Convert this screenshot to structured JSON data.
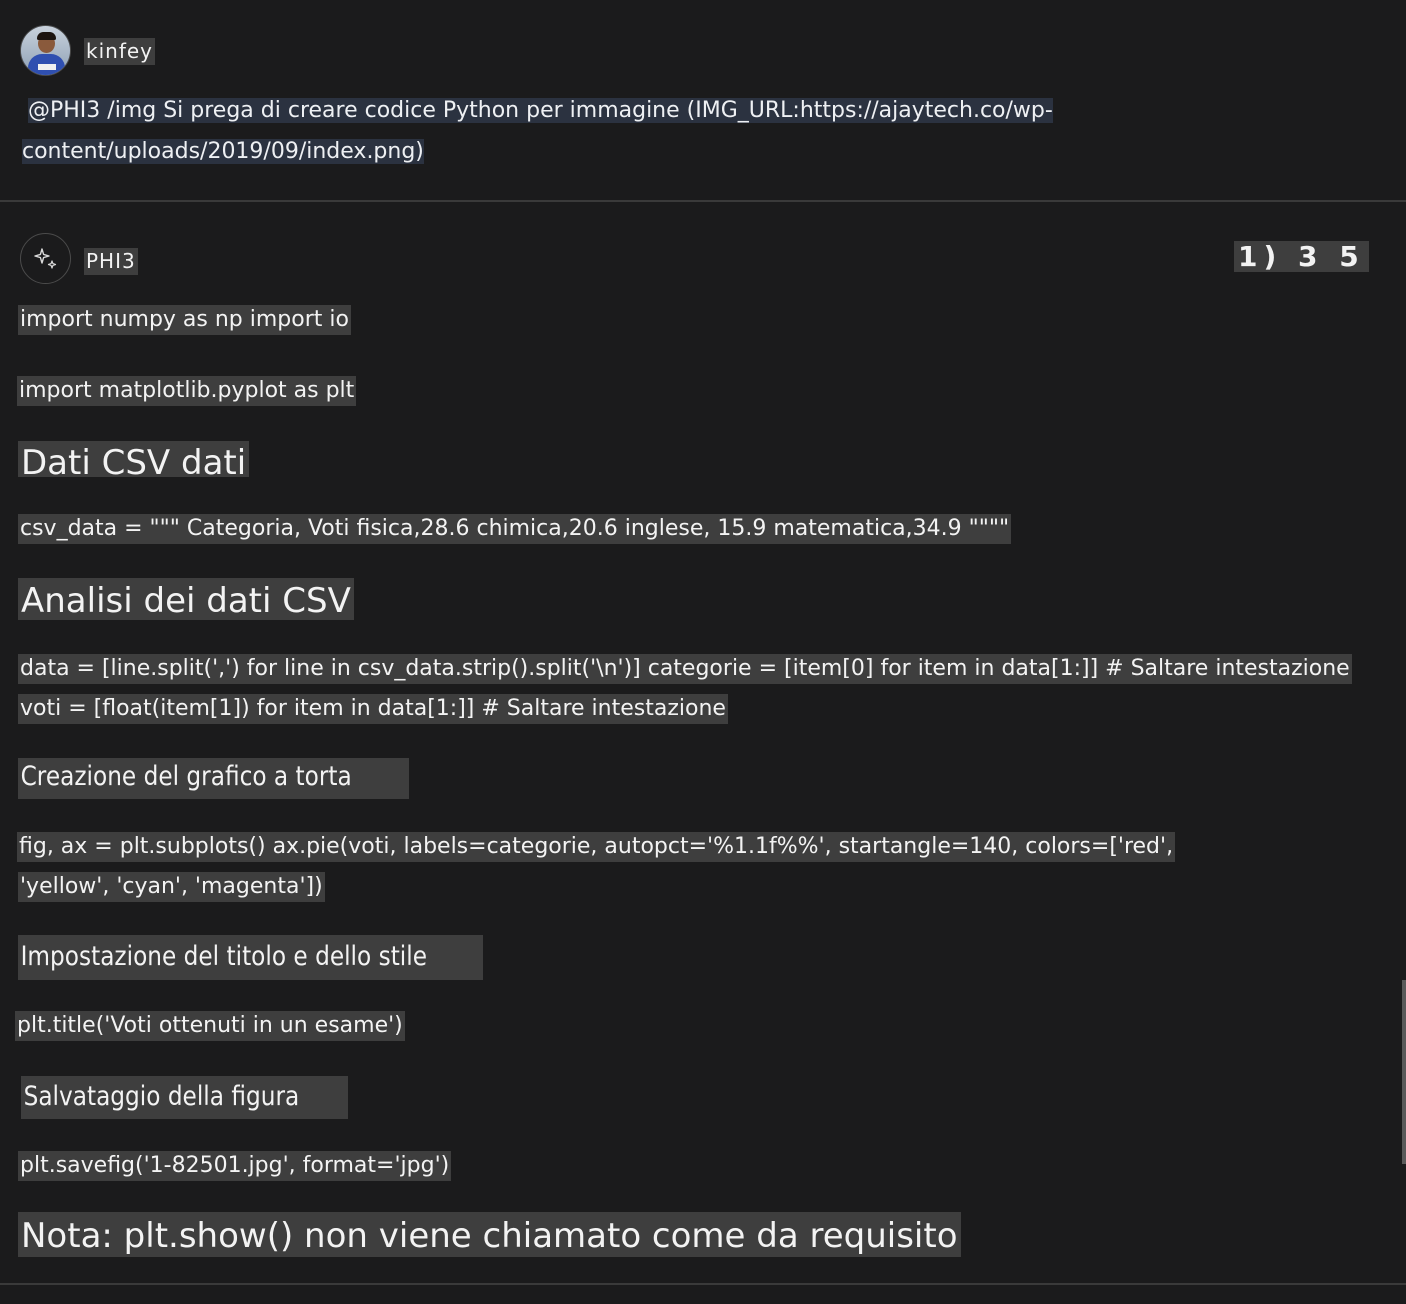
{
  "user": {
    "name": "kinfey",
    "prompt_line1": "@PHI3 /img Si prega di creare codice Python per immagine (IMG_URL:https://ajaytech.co/wp-",
    "prompt_line2": "content/uploads/2019/09/index.png)"
  },
  "bot": {
    "name": "PHI3",
    "counter": "1) 3 5",
    "icon": "sparkle-icon"
  },
  "response": {
    "code_imports_1": "import numpy as np import io",
    "code_imports_2": "import matplotlib.pyplot as plt",
    "heading_csv": "Dati CSV dati",
    "code_csv": "csv_data = \"\"\" Categoria, Voti fisica,28.6 chimica,20.6 inglese, 15.9 matematica,34.9 \"\"\"\"",
    "heading_analysis": "Analisi dei dati CSV",
    "code_analysis_1": "data = [line.split(',') for line in csv_data.strip().split('\\n')] categorie = [item[0] for item in data[1:]] # Saltare intestazione",
    "code_analysis_2": "voti = [float(item[1]) for item in data[1:]] # Saltare intestazione",
    "heading_pie": "Creazione del grafico a torta",
    "code_pie_1": "fig, ax = plt.subplots() ax.pie(voti, labels=categorie, autopct='%1.1f%%', startangle=140, colors=['red',",
    "code_pie_2": "'yellow', 'cyan', 'magenta'])",
    "heading_title": "Impostazione del titolo e dello stile",
    "code_title": "plt.title('Voti ottenuti in un esame')",
    "heading_save": "Salvataggio della figura",
    "code_save": "plt.savefig('1-82501.jpg', format='jpg')",
    "note": "Nota: plt.show() non viene chiamato come da requisito"
  }
}
